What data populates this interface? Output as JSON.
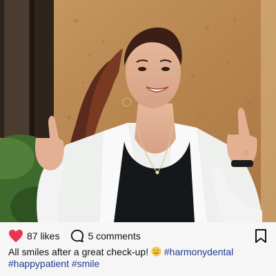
{
  "post": {
    "likes": "87 likes",
    "comments": "5 comments",
    "caption": {
      "text": "All smiles after a great check-up!",
      "emoji": "smiling-face-emoji",
      "hashtags": [
        "#harmonydental",
        "#happypatient",
        "#smile"
      ]
    },
    "icons": {
      "like": "heart-icon",
      "comment": "speech-bubble-icon",
      "save": "bookmark-icon"
    },
    "colors": {
      "heart": "#e8364f",
      "hashtag": "#1f3a8a",
      "bar_background": "#f6f6f6"
    }
  }
}
